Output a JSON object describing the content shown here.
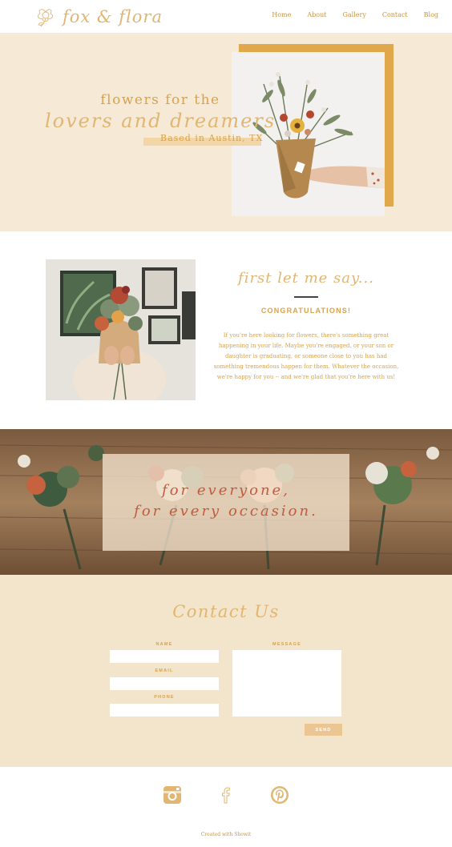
{
  "brand": {
    "logo_text": "fox & flora",
    "accent": "#d9a24b",
    "cream": "#f6ead6",
    "rust": "#c35b3c"
  },
  "nav": {
    "items": [
      {
        "label": "Home"
      },
      {
        "label": "About"
      },
      {
        "label": "Gallery"
      },
      {
        "label": "Contact"
      },
      {
        "label": "Blog"
      }
    ]
  },
  "hero": {
    "line1": "flowers for the",
    "line2": "lovers and dreamers",
    "subline": "Based in Austin, TX"
  },
  "intro": {
    "script_heading": "first let me say...",
    "heading": "CONGRATULATIONS!",
    "body": "If you're here looking for flowers, there's something great happening in your life. Maybe you're engaged, or your son or daughter is graduating, or someone close to you has had something tremendous happen for them. Whatever the occasion, we're happy for you -- and we're glad that you're here with us!"
  },
  "banner": {
    "line1": "for everyone,",
    "line2": "for every occasion."
  },
  "contact": {
    "title": "Contact Us",
    "name_label": "NAME",
    "email_label": "EMAIL",
    "phone_label": "PHONE",
    "message_label": "MESSAGE",
    "name_value": "",
    "email_value": "",
    "phone_value": "",
    "message_value": "",
    "send_label": "SEND"
  },
  "footer": {
    "social_icons": [
      "instagram-icon",
      "facebook-icon",
      "pinterest-icon"
    ],
    "credit": "Created with Showit"
  }
}
